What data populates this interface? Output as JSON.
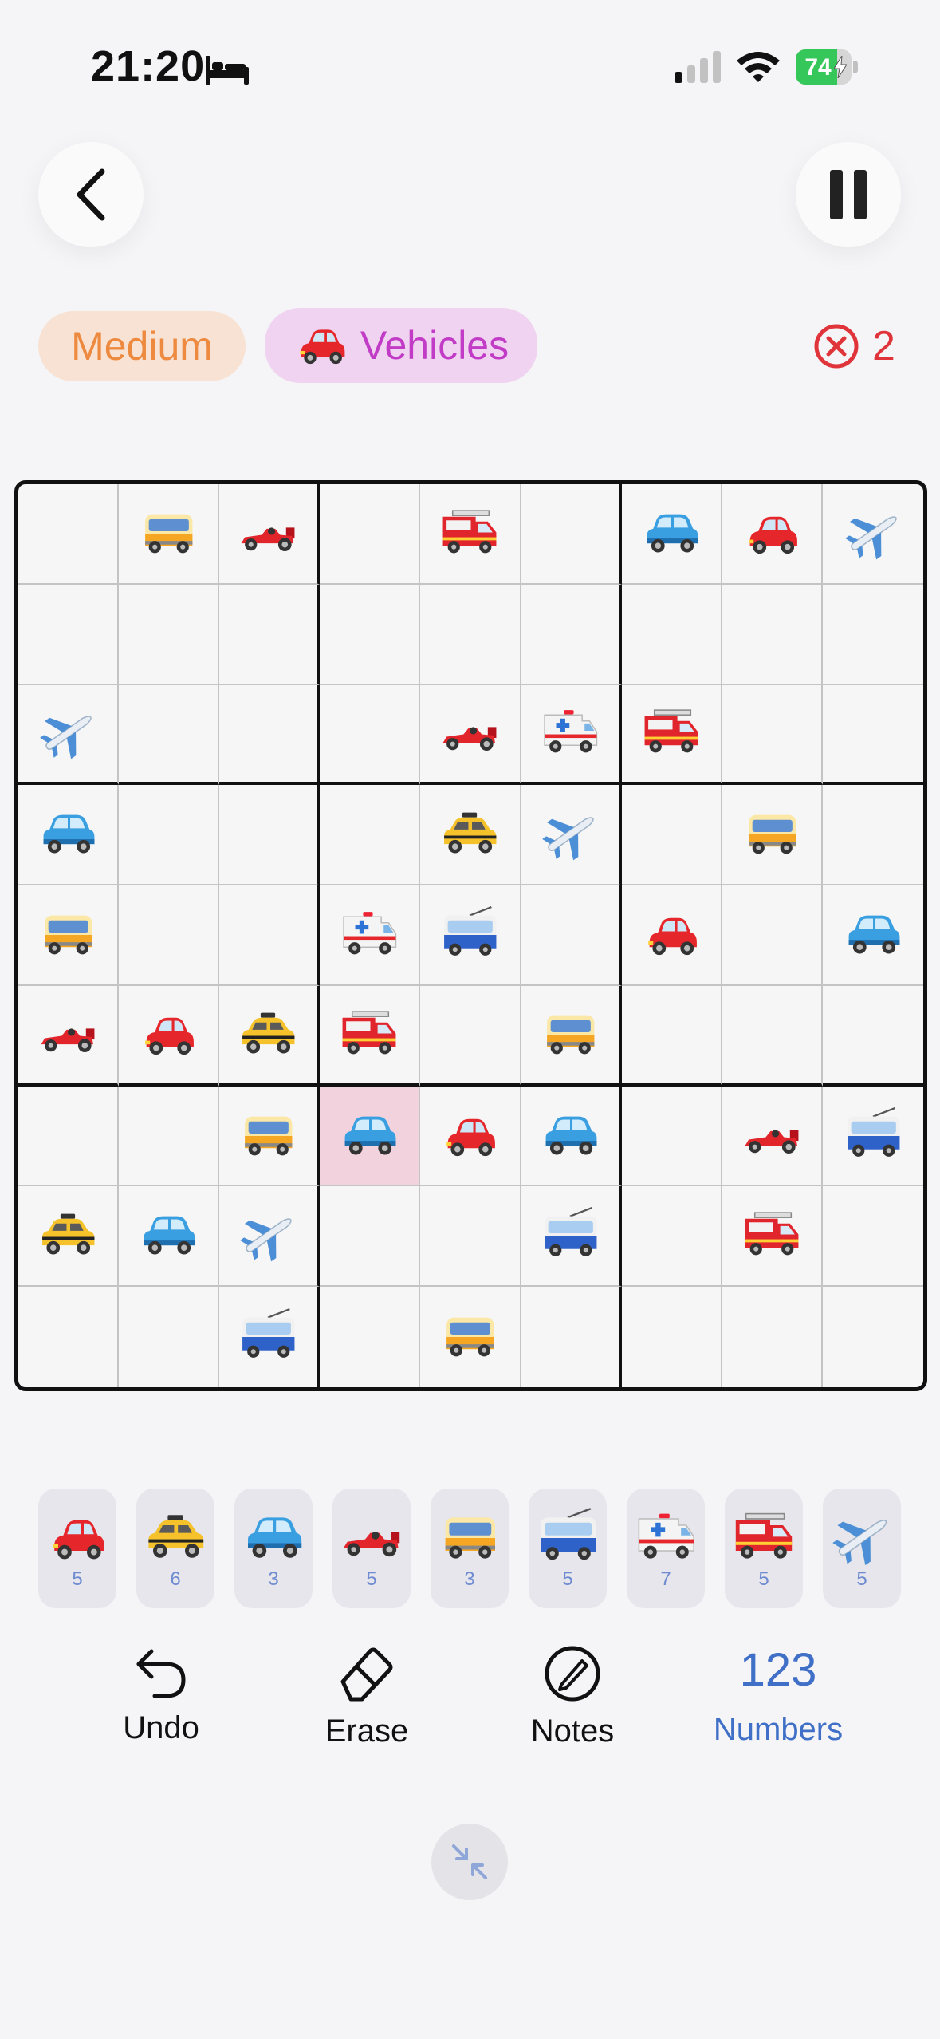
{
  "status_bar": {
    "time": "21:20",
    "battery_percent": 74
  },
  "header": {
    "difficulty": "Medium",
    "theme": "Vehicles",
    "mistakes": "2"
  },
  "board": {
    "selected": [
      6,
      3
    ],
    "cells": [
      [
        "",
        "minibus",
        "racecar",
        "",
        "firetruck",
        "",
        "bluecar",
        "redcar",
        "airplane"
      ],
      [
        "",
        "",
        "",
        "",
        "",
        "",
        "",
        "",
        ""
      ],
      [
        "airplane",
        "",
        "",
        "",
        "racecar",
        "ambulance",
        "firetruck",
        "",
        ""
      ],
      [
        "bluecar",
        "",
        "",
        "",
        "taxi",
        "airplane",
        "",
        "minibus",
        ""
      ],
      [
        "minibus",
        "",
        "",
        "ambulance",
        "trolleybus",
        "",
        "redcar",
        "",
        "bluecar"
      ],
      [
        "racecar",
        "redcar",
        "taxi",
        "firetruck",
        "",
        "minibus",
        "",
        "",
        ""
      ],
      [
        "",
        "",
        "minibus",
        "bluecar",
        "redcar",
        "bluecar",
        "",
        "racecar",
        "trolleybus"
      ],
      [
        "taxi",
        "bluecar",
        "airplane",
        "",
        "",
        "trolleybus",
        "",
        "firetruck",
        ""
      ],
      [
        "",
        "",
        "trolleybus",
        "",
        "minibus",
        "",
        "",
        "",
        ""
      ]
    ]
  },
  "number_pad": [
    {
      "icon": "redcar",
      "count": "5"
    },
    {
      "icon": "taxi",
      "count": "6"
    },
    {
      "icon": "bluecar",
      "count": "3"
    },
    {
      "icon": "racecar",
      "count": "5"
    },
    {
      "icon": "minibus",
      "count": "3"
    },
    {
      "icon": "trolleybus",
      "count": "5"
    },
    {
      "icon": "ambulance",
      "count": "7"
    },
    {
      "icon": "firetruck",
      "count": "5"
    },
    {
      "icon": "airplane",
      "count": "5"
    }
  ],
  "tools": {
    "undo": "Undo",
    "erase": "Erase",
    "notes": "Notes",
    "numbers_value": "123",
    "numbers": "Numbers"
  }
}
